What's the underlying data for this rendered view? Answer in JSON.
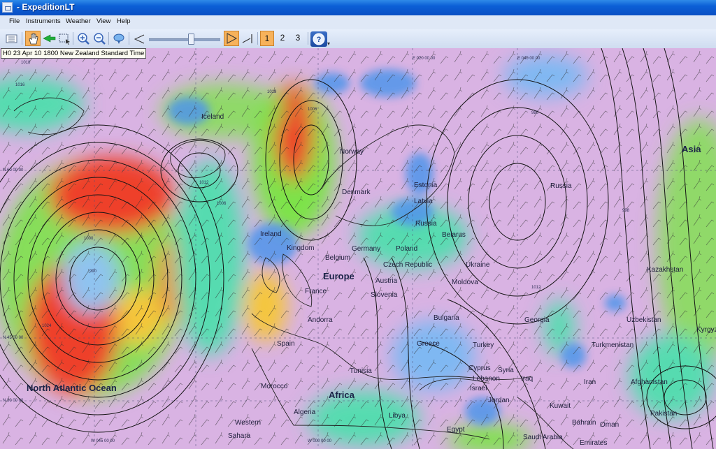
{
  "window": {
    "title": "- ExpeditionLT"
  },
  "menu": {
    "items": [
      "File",
      "Instruments",
      "Weather",
      "View",
      "Help"
    ]
  },
  "toolbar": {
    "buttons": [
      "list-icon",
      "hand-icon",
      "arrow-icon",
      "select-box-icon",
      "zoom-in-icon",
      "zoom-out-icon",
      "pin-icon",
      "slider-start-icon",
      "play-icon",
      "slider-end-icon"
    ],
    "slider_position": 0.6,
    "view_numbers": [
      "1",
      "2",
      "3"
    ],
    "selected_view": "1"
  },
  "map": {
    "time_label": "H0 23 Apr 10 1800 New Zealand Standard Time",
    "colors": {
      "calm": "#d9b3e3",
      "light": "#7fb8f2",
      "moderate": "#57dbb0",
      "fresh": "#7de24a",
      "strong": "#f5c63a",
      "gale": "#ee3f2a",
      "land_line": "#1a1a1a"
    },
    "places": {
      "iceland": "Iceland",
      "norway": "Norway",
      "denmark": "Denmark",
      "estonia": "Estonia",
      "latvia": "Latvia",
      "russia_west": "Russia",
      "russia_east": "Russia",
      "asia": "Asia",
      "ireland": "Ireland",
      "kingdom": "Kingdom",
      "belgium": "Belgium",
      "germany": "Germany",
      "poland": "Poland",
      "belarus": "Belarus",
      "czech": "Czech Republic",
      "ukraine": "Ukraine",
      "europe": "Europe",
      "austria": "Austria",
      "moldova": "Moldova",
      "france": "France",
      "slovenia": "Slovenia",
      "kazakhstan": "Kazakhstan",
      "georgia": "Georgia",
      "uzbekistan": "Uzbekistan",
      "kyrgyzstan": "Kyrgyzs",
      "andorra": "Andorra",
      "bulgaria": "Bulgaria",
      "spain": "Spain",
      "greece": "Greece",
      "turkey": "Turkey",
      "turkmenistan": "Turkmenistan",
      "north_atlantic": "North Atlantic Ocean",
      "tunisia": "Tunisia",
      "cyprus": "Cyprus",
      "syria": "Syria",
      "lebanon": "Lebanon",
      "iraq": "Iraq",
      "iran": "Iran",
      "afghanistan": "Afghanistan",
      "morocco": "Morocco",
      "africa": "Africa",
      "israel": "Israel",
      "jordan": "Jordan",
      "kuwait": "Kuwait",
      "pakistan": "Pakistan",
      "algeria": "Algeria",
      "libya": "Libya",
      "egypt": "Egypt",
      "western_sahara": "Western",
      "sahara": "Sahara",
      "saudi_arabia": "Saudi Arabia",
      "bahrain": "Bahrain",
      "oman": "Oman",
      "emirates": "Emirates"
    },
    "coords": {
      "lat60": "N 60 00 00",
      "lat45": "N 45 00 00",
      "lat30": "N 30 00 00",
      "lon_w45": "W 045 00 00",
      "lon_0": "W 000 00 00",
      "lon_e20": "E 020 00 00",
      "lon_e40": "E 040 00 00"
    },
    "isobar_labels": {
      "p1": "1018",
      "p2": "1012",
      "p3": "1006",
      "p4": "1000",
      "p5": "990",
      "p6": "980",
      "p7": "1024",
      "p8": "1018",
      "p9": "1006",
      "p10": "1012",
      "p11": "998",
      "p12": "1016"
    }
  }
}
